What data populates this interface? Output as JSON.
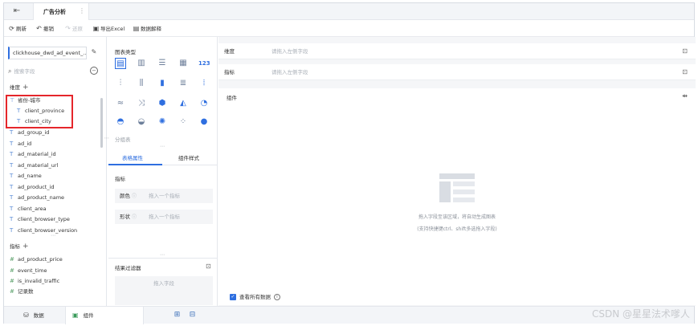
{
  "tabbar": {
    "back_icon": "exit-icon",
    "active_tab": "广告分析",
    "more": "⋮"
  },
  "toolbar": {
    "refresh": "刷新",
    "undo": "撤销",
    "redo": "还原",
    "export": "导出Excel",
    "explain": "数据解释"
  },
  "left": {
    "datasource": "clickhouse_dwd_ad_event_...",
    "search_placeholder": "搜索字段",
    "dimension_title": "维度",
    "group_name": "省份-城市",
    "group_children": [
      "client_province",
      "client_city"
    ],
    "dimensions": [
      "ad_group_id",
      "ad_id",
      "ad_material_id",
      "ad_material_url",
      "ad_name",
      "ad_product_id",
      "ad_product_name",
      "client_area",
      "client_browser_type",
      "client_browser_version"
    ],
    "measure_title": "指标",
    "measures": [
      "ad_product_price",
      "event_time",
      "is_invalid_traffic"
    ],
    "record_count": "记录数"
  },
  "middle": {
    "chart_type_title": "图表类型",
    "chart_text_icon": "123",
    "group_table": "分组表",
    "tab_table_props": "表格属性",
    "tab_component_style": "组件样式",
    "metrics_title": "指标",
    "color_label": "颜色",
    "color_placeholder": "拖入一个指标",
    "shape_label": "形状",
    "shape_placeholder": "拖入一个指标",
    "filter_title": "结果过滤器",
    "filter_placeholder": "拖入字段"
  },
  "right": {
    "dimension_label": "维度",
    "dimension_placeholder": "请拖入左侧字段",
    "metric_label": "指标",
    "metric_placeholder": "请拖入左侧字段",
    "canvas_label": "组件",
    "empty_line1": "拖入字段至该区域，将自动生成图表",
    "empty_line2": "(支持快捷键ctrl、shift多选拖入字段)",
    "show_all": "查看所有数据"
  },
  "bottombar": {
    "data_tab": "数据",
    "component_tab": "组件"
  },
  "watermark": "CSDN @星星法术嗲人",
  "colors": {
    "accent": "#2f6fe0",
    "highlight": "#e5262b"
  }
}
